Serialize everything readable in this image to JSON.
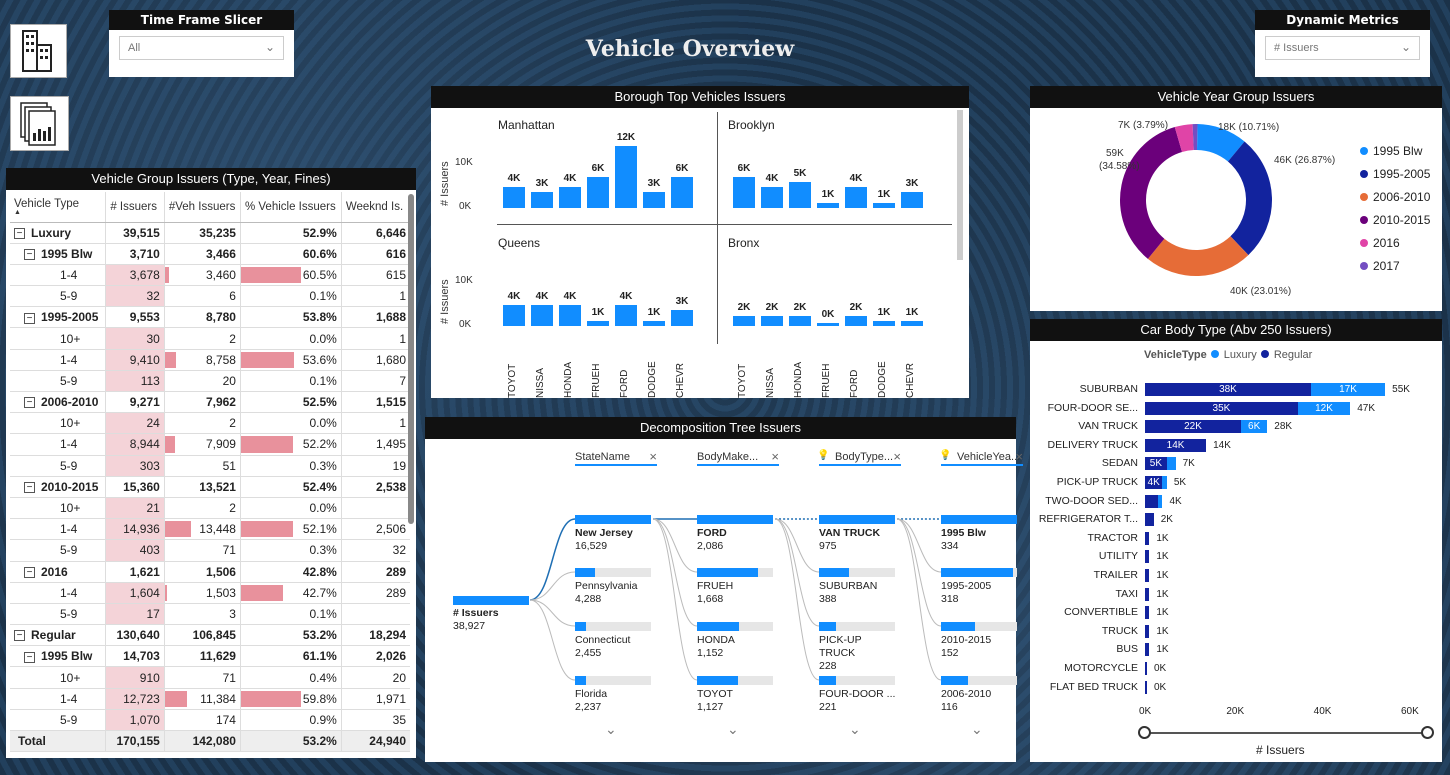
{
  "title": "Vehicle Overview",
  "colors": {
    "blue": "#118dff",
    "navy": "#12239e",
    "orange": "#e66c37",
    "purple": "#6b007b",
    "pink": "#e044a7",
    "violet": "#744ec2",
    "pinkbar": "#e8919c",
    "lightpink": "#f4d3d8"
  },
  "slicer_time": {
    "title": "Time Frame Slicer",
    "value": "All"
  },
  "slicer_metric": {
    "title": "Dynamic Metrics",
    "value": "# Issuers"
  },
  "matrix": {
    "title": "Vehicle Group Issuers (Type, Year, Fines)",
    "headers": [
      "Vehicle Type",
      "# Issuers",
      "#Veh Issuers",
      "% Vehicle Issuers",
      "Weeknd Is."
    ],
    "rows": [
      {
        "level": 0,
        "label": "Luxury",
        "v": [
          "39,515",
          "35,235",
          "52.9%",
          "6,646"
        ]
      },
      {
        "level": 1,
        "label": "1995 Blw",
        "v": [
          "3,710",
          "3,466",
          "60.6%",
          "616"
        ]
      },
      {
        "level": 2,
        "label": "1-4",
        "v": [
          "3,678",
          "3,460",
          "60.5%",
          "615"
        ],
        "b": [
          0.25,
          0.06,
          0.6
        ]
      },
      {
        "level": 2,
        "label": "5-9",
        "v": [
          "32",
          "6",
          "0.1%",
          "1"
        ],
        "b": [
          0.02,
          0,
          0
        ]
      },
      {
        "level": 1,
        "label": "1995-2005",
        "v": [
          "9,553",
          "8,780",
          "53.8%",
          "1,688"
        ]
      },
      {
        "level": 2,
        "label": "10+",
        "v": [
          "30",
          "2",
          "0.0%",
          "1"
        ],
        "b": [
          0.02,
          0,
          0
        ]
      },
      {
        "level": 2,
        "label": "1-4",
        "v": [
          "9,410",
          "8,758",
          "53.6%",
          "1,680"
        ],
        "b": [
          0.63,
          0.15,
          0.53
        ]
      },
      {
        "level": 2,
        "label": "5-9",
        "v": [
          "113",
          "20",
          "0.1%",
          "7"
        ],
        "b": [
          0.03,
          0,
          0
        ]
      },
      {
        "level": 1,
        "label": "2006-2010",
        "v": [
          "9,271",
          "7,962",
          "52.5%",
          "1,515"
        ]
      },
      {
        "level": 2,
        "label": "10+",
        "v": [
          "24",
          "2",
          "0.0%",
          "1"
        ],
        "b": [
          0.02,
          0,
          0
        ]
      },
      {
        "level": 2,
        "label": "1-4",
        "v": [
          "8,944",
          "7,909",
          "52.2%",
          "1,495"
        ],
        "b": [
          0.6,
          0.14,
          0.52
        ]
      },
      {
        "level": 2,
        "label": "5-9",
        "v": [
          "303",
          "51",
          "0.3%",
          "19"
        ],
        "b": [
          0.04,
          0,
          0
        ]
      },
      {
        "level": 1,
        "label": "2010-2015",
        "v": [
          "15,360",
          "13,521",
          "52.4%",
          "2,538"
        ]
      },
      {
        "level": 2,
        "label": "10+",
        "v": [
          "21",
          "2",
          "0.0%",
          ""
        ],
        "b": [
          0.02,
          0,
          0
        ]
      },
      {
        "level": 2,
        "label": "1-4",
        "v": [
          "14,936",
          "13,448",
          "52.1%",
          "2,506"
        ],
        "b": [
          1.0,
          0.35,
          0.52
        ]
      },
      {
        "level": 2,
        "label": "5-9",
        "v": [
          "403",
          "71",
          "0.3%",
          "32"
        ],
        "b": [
          0.04,
          0,
          0
        ]
      },
      {
        "level": 1,
        "label": "2016",
        "v": [
          "1,621",
          "1,506",
          "42.8%",
          "289"
        ]
      },
      {
        "level": 2,
        "label": "1-4",
        "v": [
          "1,604",
          "1,503",
          "42.7%",
          "289"
        ],
        "b": [
          0.11,
          0.03,
          0.42
        ]
      },
      {
        "level": 2,
        "label": "5-9",
        "v": [
          "17",
          "3",
          "0.1%",
          ""
        ],
        "b": [
          0.02,
          0,
          0
        ]
      },
      {
        "level": 0,
        "label": "Regular",
        "v": [
          "130,640",
          "106,845",
          "53.2%",
          "18,294"
        ]
      },
      {
        "level": 1,
        "label": "1995 Blw",
        "v": [
          "14,703",
          "11,629",
          "61.1%",
          "2,026"
        ]
      },
      {
        "level": 2,
        "label": "10+",
        "v": [
          "910",
          "71",
          "0.4%",
          "20"
        ],
        "b": [
          0.07,
          0,
          0
        ]
      },
      {
        "level": 2,
        "label": "1-4",
        "v": [
          "12,723",
          "11,384",
          "59.8%",
          "1,971"
        ],
        "b": [
          0.85,
          0.3,
          0.6
        ]
      },
      {
        "level": 2,
        "label": "5-9",
        "v": [
          "1,070",
          "174",
          "0.9%",
          "35"
        ],
        "b": [
          0.08,
          0,
          0
        ]
      }
    ],
    "total": {
      "label": "Total",
      "v": [
        "170,155",
        "142,080",
        "53.2%",
        "24,940"
      ]
    }
  },
  "borough": {
    "title": "Borough Top Vehicles Issuers",
    "ylabel": "# Issuers",
    "ticks": [
      "10K",
      "0K"
    ],
    "categories": [
      "TOYOT",
      "NISSA",
      "HONDA",
      "FRUEH",
      "FORD",
      "DODGE",
      "CHEVR"
    ],
    "panels": [
      {
        "name": "Manhattan",
        "values": [
          4,
          3,
          4,
          6,
          12,
          3,
          6
        ],
        "labels": [
          "4K",
          "3K",
          "4K",
          "6K",
          "12K",
          "3K",
          "6K"
        ]
      },
      {
        "name": "Brooklyn",
        "values": [
          6,
          4,
          5,
          1,
          4,
          1,
          3
        ],
        "labels": [
          "6K",
          "4K",
          "5K",
          "1K",
          "4K",
          "1K",
          "3K"
        ]
      },
      {
        "name": "Queens",
        "values": [
          4,
          4,
          4,
          1,
          4,
          1,
          3
        ],
        "labels": [
          "4K",
          "4K",
          "4K",
          "1K",
          "4K",
          "1K",
          "3K"
        ]
      },
      {
        "name": "Bronx",
        "values": [
          2,
          2,
          2,
          0.3,
          2,
          1,
          1
        ],
        "labels": [
          "2K",
          "2K",
          "2K",
          "0K",
          "2K",
          "1K",
          "1K"
        ]
      }
    ]
  },
  "decomp": {
    "title": "Decomposition Tree Issuers",
    "headers": [
      "StateName",
      "BodyMake...",
      "BodyType...",
      "VehicleYea..."
    ],
    "root": {
      "label": "# Issuers",
      "value": "38,927"
    },
    "cols": [
      [
        {
          "l": "New Jersey",
          "v": "16,529",
          "f": 1.0
        },
        {
          "l": "Pennsylvania",
          "v": "4,288",
          "f": 0.26
        },
        {
          "l": "Connecticut",
          "v": "2,455",
          "f": 0.15
        },
        {
          "l": "Florida",
          "v": "2,237",
          "f": 0.14
        }
      ],
      [
        {
          "l": "FORD",
          "v": "2,086",
          "f": 1.0
        },
        {
          "l": "FRUEH",
          "v": "1,668",
          "f": 0.8
        },
        {
          "l": "HONDA",
          "v": "1,152",
          "f": 0.55
        },
        {
          "l": "TOYOT",
          "v": "1,127",
          "f": 0.54
        }
      ],
      [
        {
          "l": "VAN TRUCK",
          "v": "975",
          "f": 1.0
        },
        {
          "l": "SUBURBAN",
          "v": "388",
          "f": 0.4
        },
        {
          "l": "PICK-UP TRUCK",
          "v": "228",
          "f": 0.23
        },
        {
          "l": "FOUR-DOOR ...",
          "v": "221",
          "f": 0.23
        }
      ],
      [
        {
          "l": "1995 Blw",
          "v": "334",
          "f": 1.0
        },
        {
          "l": "1995-2005",
          "v": "318",
          "f": 0.95
        },
        {
          "l": "2010-2015",
          "v": "152",
          "f": 0.45
        },
        {
          "l": "2006-2010",
          "v": "116",
          "f": 0.35
        }
      ]
    ]
  },
  "donut": {
    "title": "Vehicle Year Group Issuers",
    "legend": [
      "1995 Blw",
      "1995-2005",
      "2006-2010",
      "2010-2015",
      "2016",
      "2017"
    ],
    "values": [
      10.71,
      26.87,
      23.01,
      34.58,
      3.79,
      1.04
    ],
    "labels": [
      "18K (10.71%)",
      "46K (26.87%)",
      "40K (23.01%)",
      "59K",
      "(34.58%)",
      "7K (3.79%)"
    ]
  },
  "body": {
    "title": "Car Body Type (Abv 250 Issuers)",
    "legend_title": "VehicleType",
    "legend": [
      "Luxury",
      "Regular"
    ],
    "xlabel": "# Issuers",
    "xticks": [
      "0K",
      "20K",
      "40K",
      "60K"
    ],
    "xmax": 60,
    "rows": [
      {
        "c": "SUBURBAN",
        "r": 38,
        "l": 17,
        "rl": "38K",
        "ll": "17K",
        "t": "55K"
      },
      {
        "c": "FOUR-DOOR SE...",
        "r": 35,
        "l": 12,
        "rl": "35K",
        "ll": "12K",
        "t": "47K"
      },
      {
        "c": "VAN TRUCK",
        "r": 22,
        "l": 6,
        "rl": "22K",
        "ll": "6K",
        "t": "28K"
      },
      {
        "c": "DELIVERY TRUCK",
        "r": 14,
        "l": 0,
        "rl": "14K",
        "ll": "",
        "t": "14K"
      },
      {
        "c": "SEDAN",
        "r": 5,
        "l": 2,
        "rl": "5K",
        "ll": "",
        "t": "7K"
      },
      {
        "c": "PICK-UP TRUCK",
        "r": 4,
        "l": 1,
        "rl": "4K",
        "ll": "",
        "t": "5K"
      },
      {
        "c": "TWO-DOOR SED...",
        "r": 3,
        "l": 1,
        "rl": "",
        "ll": "",
        "t": "4K"
      },
      {
        "c": "REFRIGERATOR T...",
        "r": 2,
        "l": 0,
        "rl": "",
        "ll": "",
        "t": "2K"
      },
      {
        "c": "TRACTOR",
        "r": 1,
        "l": 0,
        "rl": "",
        "ll": "",
        "t": "1K"
      },
      {
        "c": "UTILITY",
        "r": 1,
        "l": 0,
        "rl": "",
        "ll": "",
        "t": "1K"
      },
      {
        "c": "TRAILER",
        "r": 1,
        "l": 0,
        "rl": "",
        "ll": "",
        "t": "1K"
      },
      {
        "c": "TAXI",
        "r": 1,
        "l": 0,
        "rl": "",
        "ll": "",
        "t": "1K"
      },
      {
        "c": "CONVERTIBLE",
        "r": 1,
        "l": 0,
        "rl": "",
        "ll": "",
        "t": "1K"
      },
      {
        "c": "TRUCK",
        "r": 1,
        "l": 0,
        "rl": "",
        "ll": "",
        "t": "1K"
      },
      {
        "c": "BUS",
        "r": 1,
        "l": 0,
        "rl": "",
        "ll": "",
        "t": "1K"
      },
      {
        "c": "MOTORCYCLE",
        "r": 0.3,
        "l": 0,
        "rl": "",
        "ll": "",
        "t": "0K"
      },
      {
        "c": "FLAT BED TRUCK",
        "r": 0.3,
        "l": 0,
        "rl": "",
        "ll": "",
        "t": "0K"
      }
    ]
  }
}
